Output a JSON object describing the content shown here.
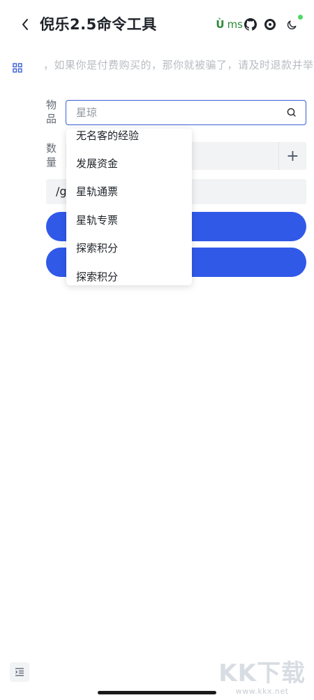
{
  "header": {
    "title": "倪乐2.5命令工具",
    "ms_badge_u": "Ù",
    "ms_badge_text": "ms",
    "icons": [
      "back-chevron",
      "github-icon",
      "ring-logo-icon",
      "moon-icon"
    ],
    "status_dot_color": "#4cd964"
  },
  "notice": {
    "text": "，如果你是付费购买的，那你就被骗了，请及时退款并举报"
  },
  "form": {
    "item_label": "物品",
    "item_search": {
      "value": "",
      "placeholder": "星琼"
    },
    "quantity_label": "数量",
    "plus_label": "+",
    "command_text": "/g"
  },
  "dropdown": {
    "options": [
      "无名客的经验",
      "发展资金",
      "星轨通票",
      "星轨专票",
      "探索积分",
      "探索积分"
    ]
  },
  "watermark": {
    "main": "KK下载",
    "url": "www.kkx.net"
  },
  "colors": {
    "accent": "#3159e8",
    "badge_green": "#2e8b3a"
  }
}
